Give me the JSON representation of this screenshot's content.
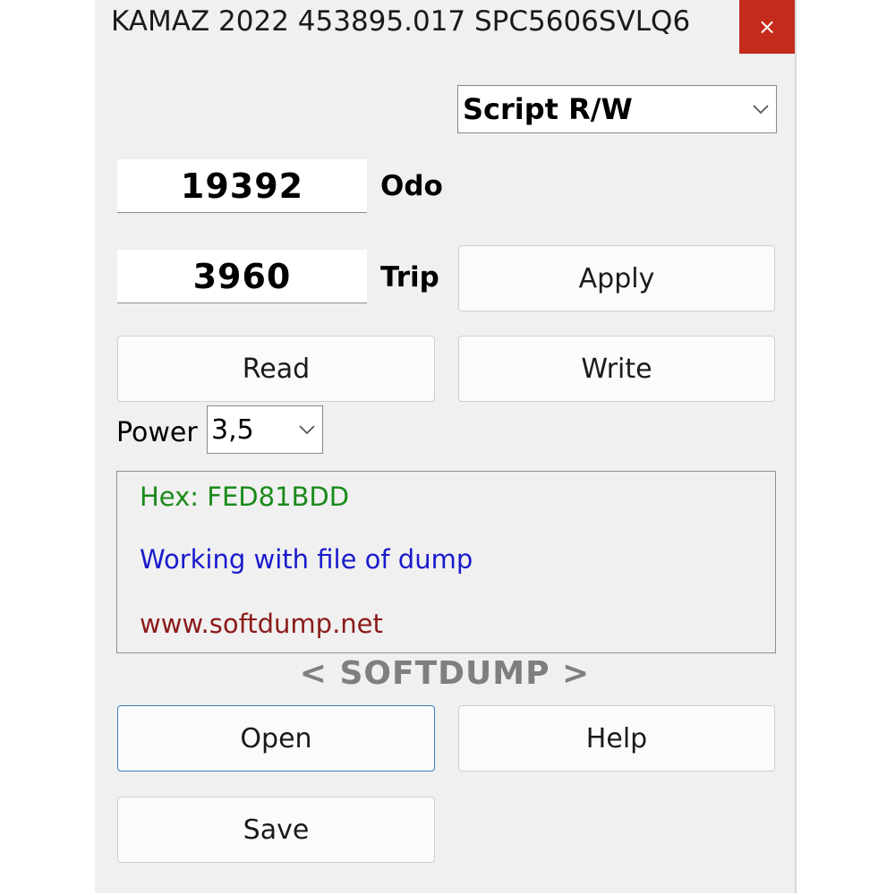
{
  "window": {
    "title": "KAMAZ 2022 453895.017 SPC5606SVLQ6",
    "close_symbol": "×"
  },
  "mode_select": {
    "value": "Script R/W",
    "icon": "chevron-down-icon"
  },
  "odo": {
    "value": "19392",
    "label": "Odo"
  },
  "trip": {
    "value": "3960",
    "label": "Trip"
  },
  "buttons": {
    "apply": "Apply",
    "read": "Read",
    "write": "Write",
    "open": "Open",
    "help": "Help",
    "save": "Save"
  },
  "power": {
    "label": "Power",
    "value": "3,5"
  },
  "log": {
    "hex": {
      "text": "Hex: FED81BDD",
      "color": "#1a8a1a"
    },
    "status": {
      "text": "Working with file of dump",
      "color": "#1a1acc"
    },
    "website": {
      "text": "www.softdump.net",
      "color": "#8b1a1a"
    }
  },
  "brand": "< SOFTDUMP >",
  "colors": {
    "close_bg": "#c42b1c",
    "window_bg": "#f0f0f0",
    "focus_border": "#3c7cc4"
  }
}
